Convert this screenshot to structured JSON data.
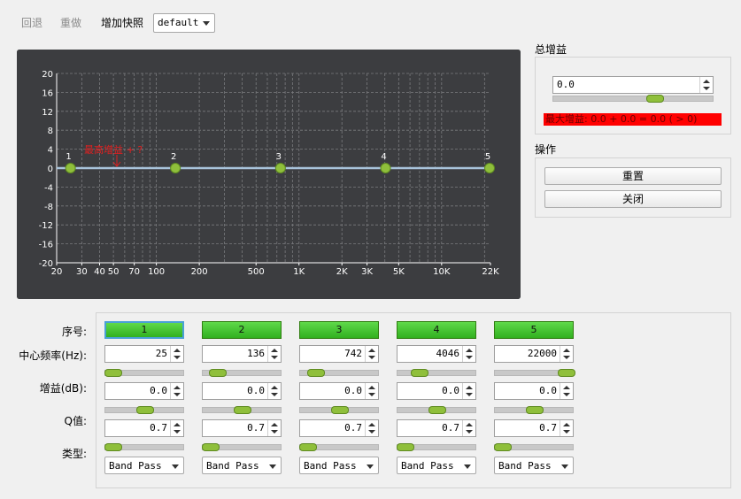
{
  "toolbar": {
    "undo_label": "回退",
    "redo_label": "重做",
    "add_snapshot_label": "增加快照",
    "snapshot_value": "default"
  },
  "graph": {
    "y_ticks": [
      "20",
      "16",
      "12",
      "8",
      "4",
      "0",
      "-4",
      "-8",
      "-12",
      "-16",
      "-20"
    ],
    "x_ticks": [
      "20",
      "30",
      "40",
      "50",
      "70",
      "100",
      "200",
      "500",
      "1K",
      "2K",
      "3K",
      "5K",
      "10K",
      "22K"
    ],
    "annotation": "最高增益 + ?",
    "points": [
      {
        "label": "1",
        "freq": 25,
        "gain": 0
      },
      {
        "label": "2",
        "freq": 136,
        "gain": 0
      },
      {
        "label": "3",
        "freq": 742,
        "gain": 0
      },
      {
        "label": "4",
        "freq": 4046,
        "gain": 0
      },
      {
        "label": "5",
        "freq": 22000,
        "gain": 0
      }
    ],
    "colors": {
      "background": "#3c3d40",
      "curve": "#a9c4dc",
      "point": "#8fbf3b",
      "annotation": "#e02020"
    }
  },
  "total_gain": {
    "title": "总增益",
    "value": "0.0",
    "slider_level": 0.5,
    "warning": "最大增益: 0.0 + 0.0 = 0.0 ( > 0)"
  },
  "operations": {
    "title": "操作",
    "reset_label": "重置",
    "close_label": "关闭"
  },
  "bands": {
    "labels": {
      "index": "序号:",
      "freq": "中心频率(Hz):",
      "gain": "增益(dB):",
      "q": "Q值:",
      "type": "类型:"
    },
    "items": [
      {
        "index": "1",
        "freq": "25",
        "freq_level": 0.02,
        "gain": "0.0",
        "gain_level": 0.5,
        "q": "0.7",
        "q_level": 0.02,
        "type": "Band Pass",
        "selected": true
      },
      {
        "index": "2",
        "freq": "136",
        "freq_level": 0.12,
        "gain": "0.0",
        "gain_level": 0.5,
        "q": "0.7",
        "q_level": 0.02,
        "type": "Band Pass",
        "selected": false
      },
      {
        "index": "3",
        "freq": "742",
        "freq_level": 0.13,
        "gain": "0.0",
        "gain_level": 0.5,
        "q": "0.7",
        "q_level": 0.02,
        "type": "Band Pass",
        "selected": false
      },
      {
        "index": "4",
        "freq": "4046",
        "freq_level": 0.23,
        "gain": "0.0",
        "gain_level": 0.5,
        "q": "0.7",
        "q_level": 0.02,
        "type": "Band Pass",
        "selected": false
      },
      {
        "index": "5",
        "freq": "22000",
        "freq_level": 0.98,
        "gain": "0.0",
        "gain_level": 0.5,
        "q": "0.7",
        "q_level": 0.02,
        "type": "Band Pass",
        "selected": false
      }
    ]
  }
}
